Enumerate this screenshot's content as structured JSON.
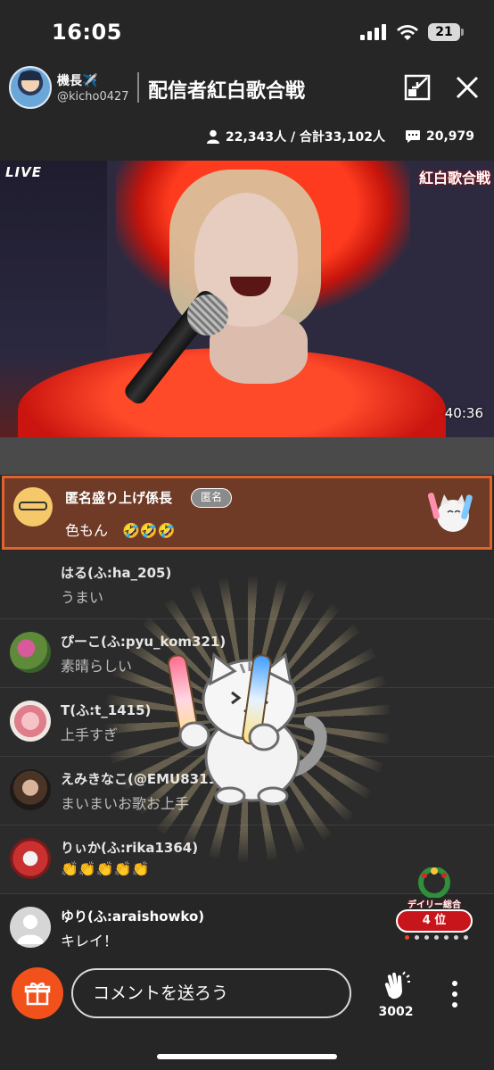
{
  "status_bar": {
    "time": "16:05",
    "battery": "21"
  },
  "header": {
    "host_name": "機長✈️",
    "host_id": "@kicho0427",
    "room_title": "配信者紅白歌合戦"
  },
  "stats": {
    "viewers": "22,343人 / 合計33,102人",
    "comments": "20,979"
  },
  "video": {
    "live_label": "LIVE",
    "logo_text": "紅白歌合戦",
    "elapsed": "40:36"
  },
  "pinned_comment": {
    "name": "匿名盛り上げ係長",
    "badge": "匿名",
    "message": "色もん　🤣🤣🤣"
  },
  "comments": [
    {
      "name": "はる(ふ:ha_205)",
      "message": "うまい"
    },
    {
      "name": "ぴーこ(ふ:pyu_kom321)",
      "message": "素晴らしい"
    },
    {
      "name": "T(ふ:t_1415)",
      "message": "上手すぎ"
    },
    {
      "name": "えみきなこ(@EMU8311",
      "message": "まいまいお歌お上手"
    },
    {
      "name": "りぃか(ふ:rika1364)",
      "message": "👏👏👏👏👏"
    },
    {
      "name": "ゆり(ふ:araishowko)",
      "message": "キレイ！"
    }
  ],
  "ranking": {
    "badge_text": "デイリー総合",
    "rank": "4 位"
  },
  "bottom_bar": {
    "comment_placeholder": "コメントを送ろう",
    "clap_count": "3002"
  },
  "colors": {
    "accent": "#f2511b",
    "pinned_bg": "#6f3b27",
    "pinned_border": "#e0632c",
    "rank_red": "#c8151b"
  }
}
